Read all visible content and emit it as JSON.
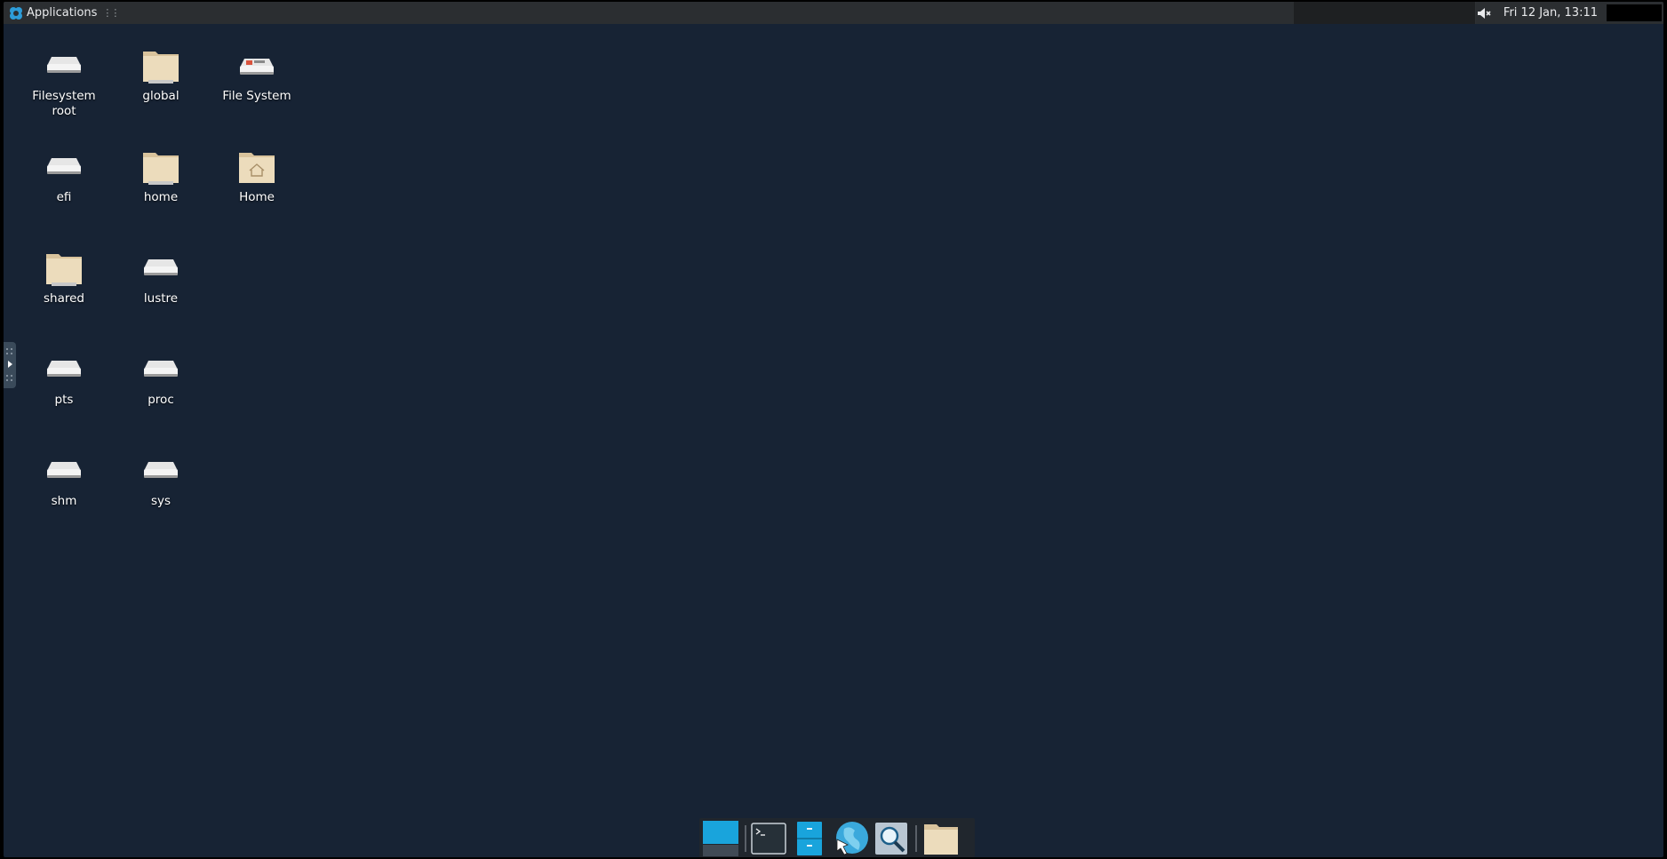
{
  "top_panel": {
    "applications_label": "Applications",
    "clock": "Fri 12 Jan, 13:11"
  },
  "desktop": {
    "icons": [
      {
        "label": "Filesystem root",
        "type": "drive"
      },
      {
        "label": "global",
        "type": "folder-drive"
      },
      {
        "label": "File System",
        "type": "drive-media"
      },
      {
        "label": "efi",
        "type": "drive"
      },
      {
        "label": "home",
        "type": "folder-drive"
      },
      {
        "label": "Home",
        "type": "home-folder"
      },
      {
        "label": "shared",
        "type": "folder-drive"
      },
      {
        "label": "lustre",
        "type": "drive"
      },
      {
        "label": "pts",
        "type": "drive"
      },
      {
        "label": "proc",
        "type": "drive"
      },
      {
        "label": "shm",
        "type": "drive"
      },
      {
        "label": "sys",
        "type": "drive"
      }
    ]
  },
  "dock": {
    "items": [
      "show-desktop",
      "terminal",
      "file-manager",
      "web-browser",
      "app-finder",
      "folder"
    ]
  },
  "colors": {
    "desktop_background": "#172334",
    "panel_background": "#2b2e31",
    "accent": "#19a4dc",
    "folder": "#e8d6b4"
  }
}
